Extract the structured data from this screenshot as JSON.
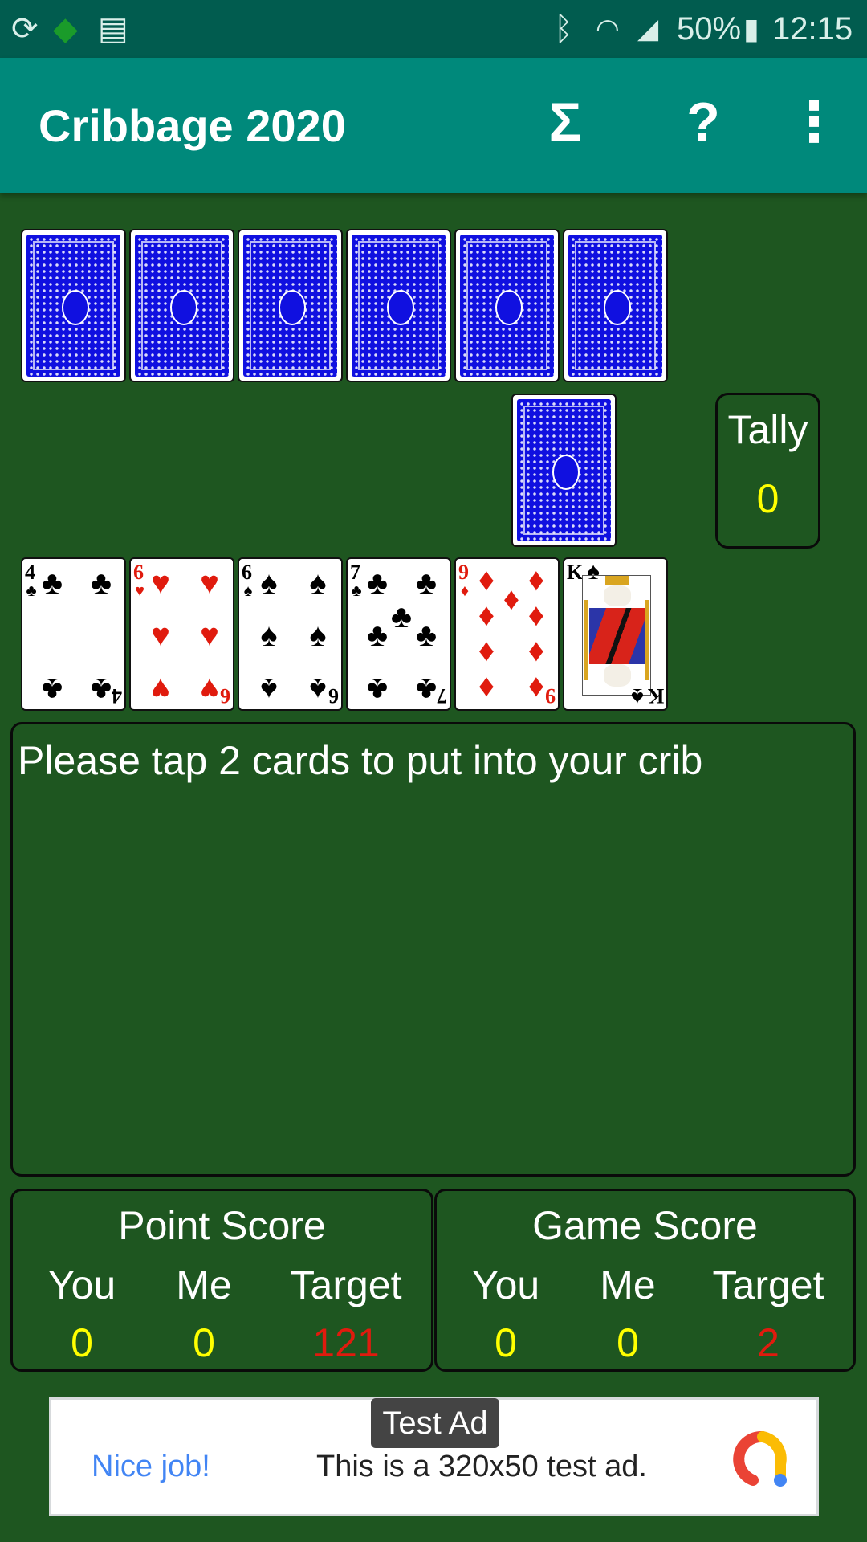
{
  "status_bar": {
    "left_icons": [
      "sync-icon",
      "australia-map-icon",
      "news-icon"
    ],
    "right_icons": [
      "bluetooth-icon",
      "wifi-icon",
      "signal-icon",
      "battery-icon"
    ],
    "battery": "50%",
    "time": "12:15"
  },
  "app_bar": {
    "title": "Cribbage 2020",
    "actions": [
      {
        "name": "statistics",
        "glyph": "Σ"
      },
      {
        "name": "help",
        "glyph": "?"
      },
      {
        "name": "more-options",
        "glyph": "⋮"
      }
    ]
  },
  "opponent_hand": {
    "count": 6,
    "face": "down"
  },
  "starter_card": {
    "face": "down"
  },
  "tally": {
    "label": "Tally",
    "value": "0"
  },
  "player_hand": [
    {
      "rank": "4",
      "suit": "clubs",
      "symbol": "♣",
      "color": "black"
    },
    {
      "rank": "6",
      "suit": "hearts",
      "symbol": "♥",
      "color": "red"
    },
    {
      "rank": "6",
      "suit": "spades",
      "symbol": "♠",
      "color": "black"
    },
    {
      "rank": "7",
      "suit": "clubs",
      "symbol": "♣",
      "color": "black"
    },
    {
      "rank": "9",
      "suit": "diamonds",
      "symbol": "♦",
      "color": "red"
    },
    {
      "rank": "K",
      "suit": "spades",
      "symbol": "♠",
      "color": "black"
    }
  ],
  "message": "Please tap 2 cards to put into your crib",
  "point_score": {
    "title": "Point Score",
    "columns": [
      {
        "label": "You",
        "value": "0",
        "color": "#ffff00"
      },
      {
        "label": "Me",
        "value": "0",
        "color": "#ffff00"
      },
      {
        "label": "Target",
        "value": "121",
        "color": "#e01b0e"
      }
    ]
  },
  "game_score": {
    "title": "Game Score",
    "columns": [
      {
        "label": "You",
        "value": "0",
        "color": "#ffff00"
      },
      {
        "label": "Me",
        "value": "0",
        "color": "#ffff00"
      },
      {
        "label": "Target",
        "value": "2",
        "color": "#e01b0e"
      }
    ]
  },
  "ad": {
    "badge": "Test Ad",
    "headline": "Nice job!",
    "body": "This is a 320x50 test ad."
  },
  "colors": {
    "felt": "#1e5620",
    "app_bar": "#00897b",
    "status_bar": "#015c4f",
    "card_back": "#1010e0",
    "score_value": "#ffff00",
    "target_value": "#e01b0e"
  }
}
